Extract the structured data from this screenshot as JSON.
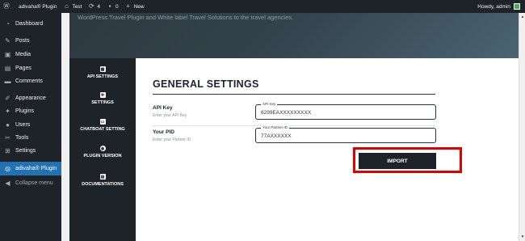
{
  "adminbar": {
    "site_name": "adivaha® Plugin",
    "site_link": "Test",
    "updates_count": "4",
    "comments_count": "0",
    "new_label": "New",
    "howdy": "Howdy, admin"
  },
  "sidebar": {
    "items": [
      {
        "label": "Dashboard",
        "icon": "gauge-icon"
      },
      {
        "label": "Posts",
        "icon": "pin-icon"
      },
      {
        "label": "Media",
        "icon": "media-icon"
      },
      {
        "label": "Pages",
        "icon": "page-icon"
      },
      {
        "label": "Comments",
        "icon": "comment-icon"
      },
      {
        "label": "Appearance",
        "icon": "brush-icon"
      },
      {
        "label": "Plugins",
        "icon": "plug-icon"
      },
      {
        "label": "Users",
        "icon": "user-icon"
      },
      {
        "label": "Tools",
        "icon": "wrench-icon"
      },
      {
        "label": "Settings",
        "icon": "settings-icon"
      },
      {
        "label": "adivaha® Plugin",
        "icon": "adivaha-icon"
      },
      {
        "label": "Collapse menu",
        "icon": "collapse-icon"
      }
    ]
  },
  "banner": {
    "text": "WordPress Travel Plugin and White label Travel Solutions to the travel agencies."
  },
  "tabs": [
    {
      "label": "API SETTINGS"
    },
    {
      "label": "SETTINGS"
    },
    {
      "label": "CHATBOAT SETTING"
    },
    {
      "label": "PLUGIN VERSION"
    },
    {
      "label": "DOCUMENTATIONS"
    }
  ],
  "main": {
    "heading": "GENERAL SETTINGS",
    "api_key": {
      "label": "API Key",
      "hint": "Enter your API Key",
      "legend": "API Key",
      "value": "6299EAXXXXXXXXX"
    },
    "pid": {
      "label": "Your PID",
      "hint": "Enter your Partner ID",
      "legend": "Your Partner ID",
      "value": "77AXXXXXX"
    },
    "import_label": "IMPORT"
  },
  "colors": {
    "admin_dark": "#1d2327",
    "accent": "#2271b1",
    "highlight": "#e00000"
  }
}
